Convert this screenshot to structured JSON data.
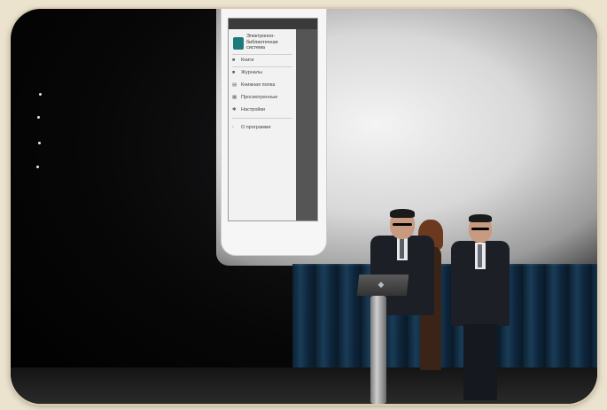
{
  "photo": {
    "subject": "presentation stage",
    "projected_app": {
      "title_line1": "Электронно-",
      "title_line2": "библиотечная",
      "title_line3": "система",
      "nav_items": [
        {
          "icon": "book-icon",
          "label": "Книги"
        },
        {
          "icon": "journal-icon",
          "label": "Журналы"
        },
        {
          "icon": "bookshelf-icon",
          "label": "Книжная полка"
        },
        {
          "icon": "history-icon",
          "label": "Просмотренные"
        },
        {
          "icon": "gear-icon",
          "label": "Настройки"
        },
        {
          "icon": "info-icon",
          "label": "О программе"
        }
      ]
    }
  },
  "colors": {
    "frame_bg": "#ece3cf",
    "stage_dark": "#070708",
    "curtain_blue": "#1b4260",
    "app_logo": "#1d7a7a"
  }
}
